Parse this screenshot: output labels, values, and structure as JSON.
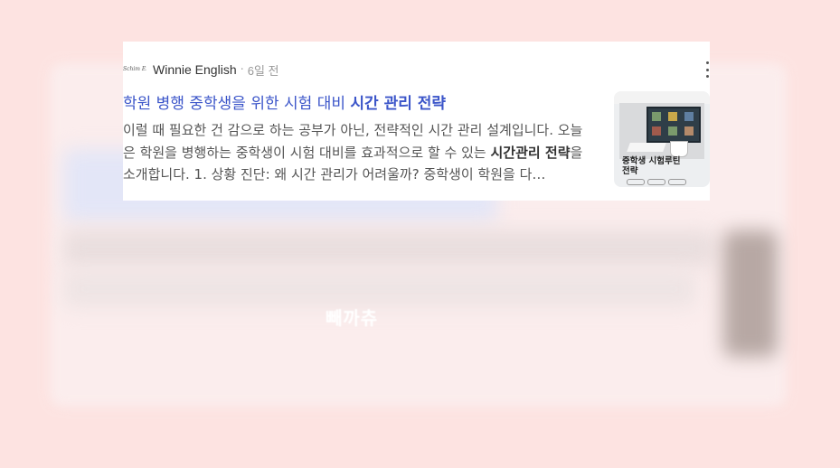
{
  "background": {
    "blurred_caption": "빼까츄"
  },
  "card": {
    "source_name": "Winnie English",
    "source_logo_text": "Schim Englis",
    "separator": "·",
    "timestamp": "6일 전",
    "more_icon": "more-vertical-icon",
    "title_prefix": "학원 병행 중학생을 위한 시험 대비 ",
    "title_emphasis": "시간 관리 전략",
    "description_part1": "이럴 때 필요한 건 감으로 하는 공부가 아닌, 전략적인 시간 관리 설계입니다. 오늘은 학원을 병행하는 중학생이 시험 대비를 효과적으로 할 수 있는 ",
    "description_emphasis": "시간관리 전략",
    "description_part2": "을 소개합니다. 1. 상황 진단: 왜 시간 관리가 어려울까? 중학생이 학원을 다…",
    "thumbnail": {
      "caption_line1": "중학생 시험루틴",
      "caption_line2": "전략"
    }
  }
}
